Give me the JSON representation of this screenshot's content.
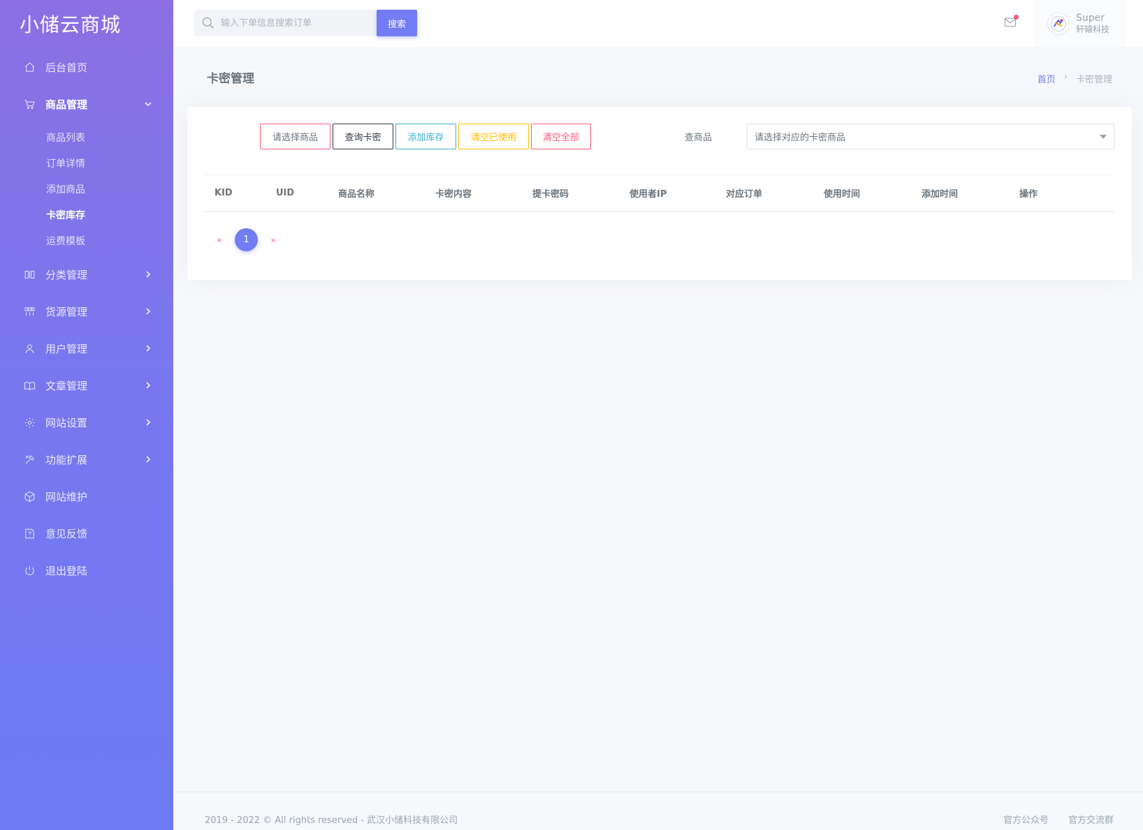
{
  "brand": "小储云商城",
  "sidebar": {
    "home": "后台首页",
    "goods": {
      "label": "商品管理",
      "items": [
        "商品列表",
        "订单详情",
        "添加商品",
        "卡密库存",
        "运费模板"
      ]
    },
    "category": "分类管理",
    "supply": "货源管理",
    "users": "用户管理",
    "articles": "文章管理",
    "settings": "网站设置",
    "extensions": "功能扩展",
    "maintenance": "网站维护",
    "feedback": "意见反馈",
    "logout": "退出登陆"
  },
  "topbar": {
    "search_placeholder": "输入下单信息搜索订单",
    "search_button": "搜索",
    "user_name": "Super",
    "user_company": "轩辕科技"
  },
  "page": {
    "title": "卡密管理",
    "breadcrumb": [
      "首页",
      "›",
      "卡密管理"
    ]
  },
  "toolbar": {
    "select_goods": "请选择商品",
    "query_card": "查询卡密",
    "add_stock": "添加库存",
    "clear_used": "清空已使用",
    "clear_all": "清空全部",
    "filter_label": "查商品",
    "filter_value": "请选择对应的卡密商品"
  },
  "table": {
    "columns": [
      "KID",
      "UID",
      "商品名称",
      "卡密内容",
      "提卡密码",
      "使用者IP",
      "对应订单",
      "使用时间",
      "添加时间",
      "操作"
    ]
  },
  "pagination": {
    "prev": "«",
    "current": "1",
    "next": "»"
  },
  "footer": {
    "copyright": "2019 - 2022 © All rights reserved - 武汉小储科技有限公司",
    "links": [
      "官方公众号",
      "官方交流群"
    ]
  },
  "colors": {
    "primary": "#727cf5",
    "danger": "#fa5c7c",
    "warning": "#ffbc00",
    "info": "#39afd1",
    "dark": "#313a46"
  }
}
